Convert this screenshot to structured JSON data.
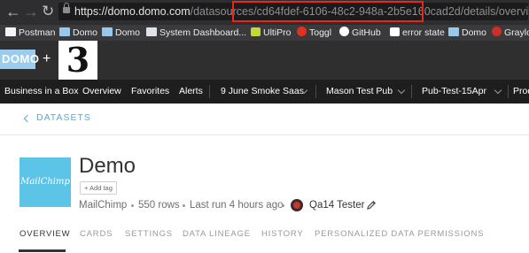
{
  "browser": {
    "url_host": "https://domo.domo.com",
    "url_path_prefix": "/datasources/",
    "url_highlight": "cd64fdef-6106-48c2-948a-2b5e160cad2d",
    "url_path_suffix": "/details/overview",
    "highlight_color": "#e8261c"
  },
  "bookmarks": [
    {
      "label": "Postman",
      "icon": "page-icon"
    },
    {
      "label": "Domo",
      "icon": "domo-icon"
    },
    {
      "label": "Domo",
      "icon": "domo-icon"
    },
    {
      "label": "System Dashboard...",
      "icon": "dashboard-icon"
    },
    {
      "label": "UltiPro",
      "icon": "ultipro-icon"
    },
    {
      "label": "Toggl",
      "icon": "toggl-icon"
    },
    {
      "label": "GitHub",
      "icon": "github-icon"
    },
    {
      "label": "error state",
      "icon": "page-icon"
    },
    {
      "label": "Domo",
      "icon": "domo-icon"
    },
    {
      "label": "Graylo",
      "icon": "graylog-icon"
    }
  ],
  "logos": {
    "domo": "DOMO",
    "plus": "+",
    "partner": "3"
  },
  "nav": {
    "items": [
      {
        "label": "Business in a Box"
      },
      {
        "label": "Overview"
      },
      {
        "label": "Favorites"
      },
      {
        "label": "Alerts"
      },
      {
        "label": "9 June Smoke Saas"
      },
      {
        "label": "Mason Test Pub"
      },
      {
        "label": "Pub-Test-15Apr"
      },
      {
        "label": "Prod"
      }
    ]
  },
  "breadcrumb": {
    "label": "DATASETS"
  },
  "dataset": {
    "icon_text": "MailChimp",
    "title": "Demo",
    "add_tag": "+ Add tag",
    "connector": "MailChimp",
    "rows": "550 rows",
    "last_run": "Last run 4 hours ago",
    "owner": "Qa14 Tester"
  },
  "tabs": [
    {
      "label": "OVERVIEW",
      "active": true
    },
    {
      "label": "CARDS",
      "active": false
    },
    {
      "label": "SETTINGS",
      "active": false
    },
    {
      "label": "DATA LINEAGE",
      "active": false
    },
    {
      "label": "HISTORY",
      "active": false
    },
    {
      "label": "PERSONALIZED DATA PERMISSIONS",
      "active": false
    }
  ],
  "colors": {
    "accent": "#59a9d3",
    "mailchimp_tile": "#5cc4e7",
    "nav_bg": "#1e1e1e"
  }
}
